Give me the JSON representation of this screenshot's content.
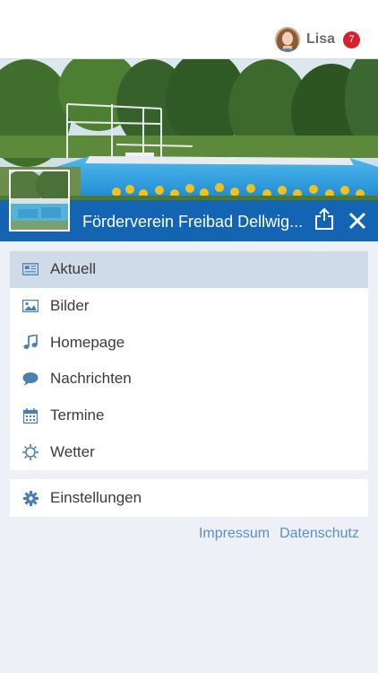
{
  "colors": {
    "brand_blue": "#1464b4",
    "icon_blue": "#4a7fb5",
    "badge_red": "#d7202a",
    "link_blue": "#5d8fbd",
    "active_bg": "#cfdbe9"
  },
  "header": {
    "user_name": "Lisa",
    "notification_count": "7"
  },
  "group": {
    "title": "Förderverein Freibad Dellwig..."
  },
  "menu": {
    "items": [
      {
        "label": "Aktuell",
        "icon": "newspaper-icon",
        "active": true
      },
      {
        "label": "Bilder",
        "icon": "image-icon",
        "active": false
      },
      {
        "label": "Homepage",
        "icon": "music-note-icon",
        "active": false
      },
      {
        "label": "Nachrichten",
        "icon": "speech-bubble-icon",
        "active": false
      },
      {
        "label": "Termine",
        "icon": "calendar-icon",
        "active": false
      },
      {
        "label": "Wetter",
        "icon": "sun-icon",
        "active": false
      }
    ]
  },
  "settings": {
    "label": "Einstellungen",
    "icon": "gear-icon"
  },
  "footer": {
    "impressum": "Impressum",
    "datenschutz": "Datenschutz"
  }
}
